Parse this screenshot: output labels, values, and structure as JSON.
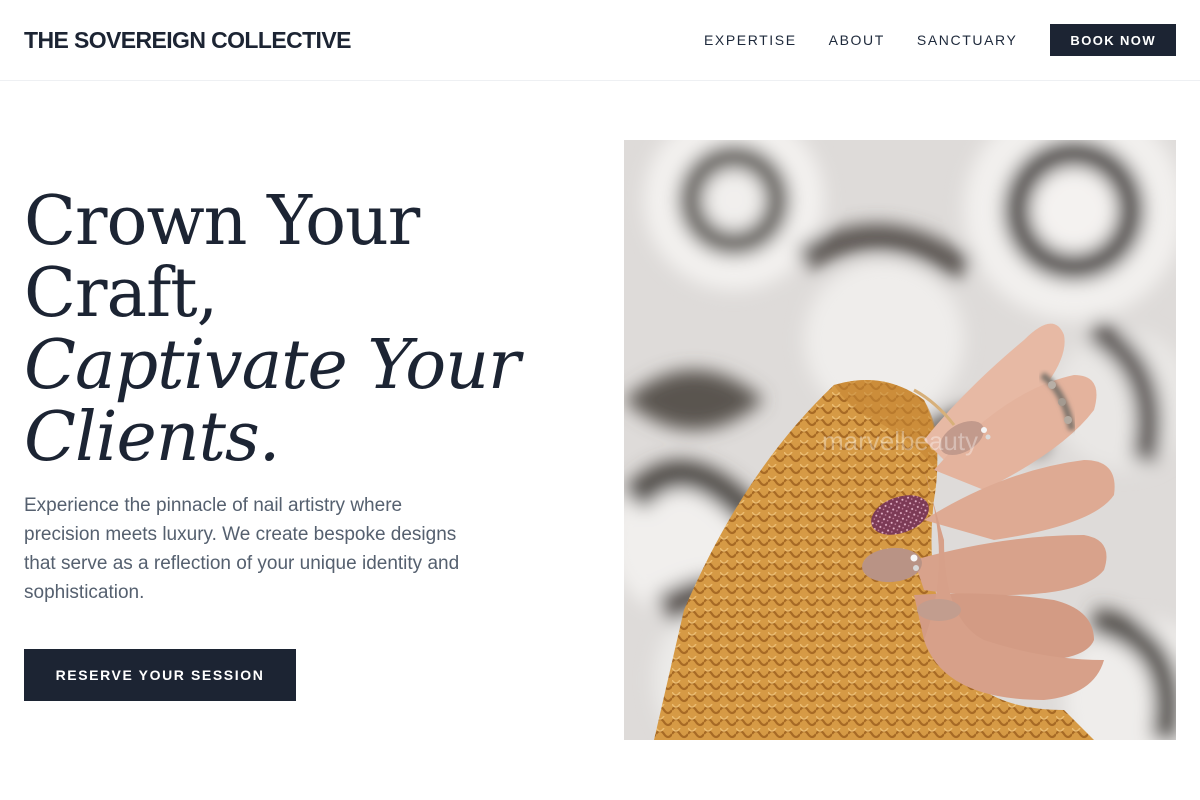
{
  "brand": {
    "name": "THE SOVEREIGN COLLECTIVE"
  },
  "nav": {
    "items": [
      {
        "label": "EXPERTISE"
      },
      {
        "label": "ABOUT"
      },
      {
        "label": "SANCTUARY"
      }
    ],
    "book_label": "BOOK NOW"
  },
  "hero": {
    "headline_lines": [
      "Crown Your",
      "Craft,",
      "Captivate Your",
      "Clients."
    ],
    "description": "Experience the pinnacle of nail artistry where precision meets luxury. We create bespoke designs that serve as a reflection of your unique identity and sophistication.",
    "cta_label": "RESERVE YOUR SESSION",
    "image": {
      "subject": "hand with manicured nails holding a mustard knit sweater over a patterned tile background",
      "watermark": "marvelbeauty"
    }
  },
  "colors": {
    "navy": "#1c2433",
    "body_text": "#55606f",
    "sweater": "#d9993f",
    "nail_nude": "#b99385",
    "nail_glitter": "#8a4a62"
  }
}
